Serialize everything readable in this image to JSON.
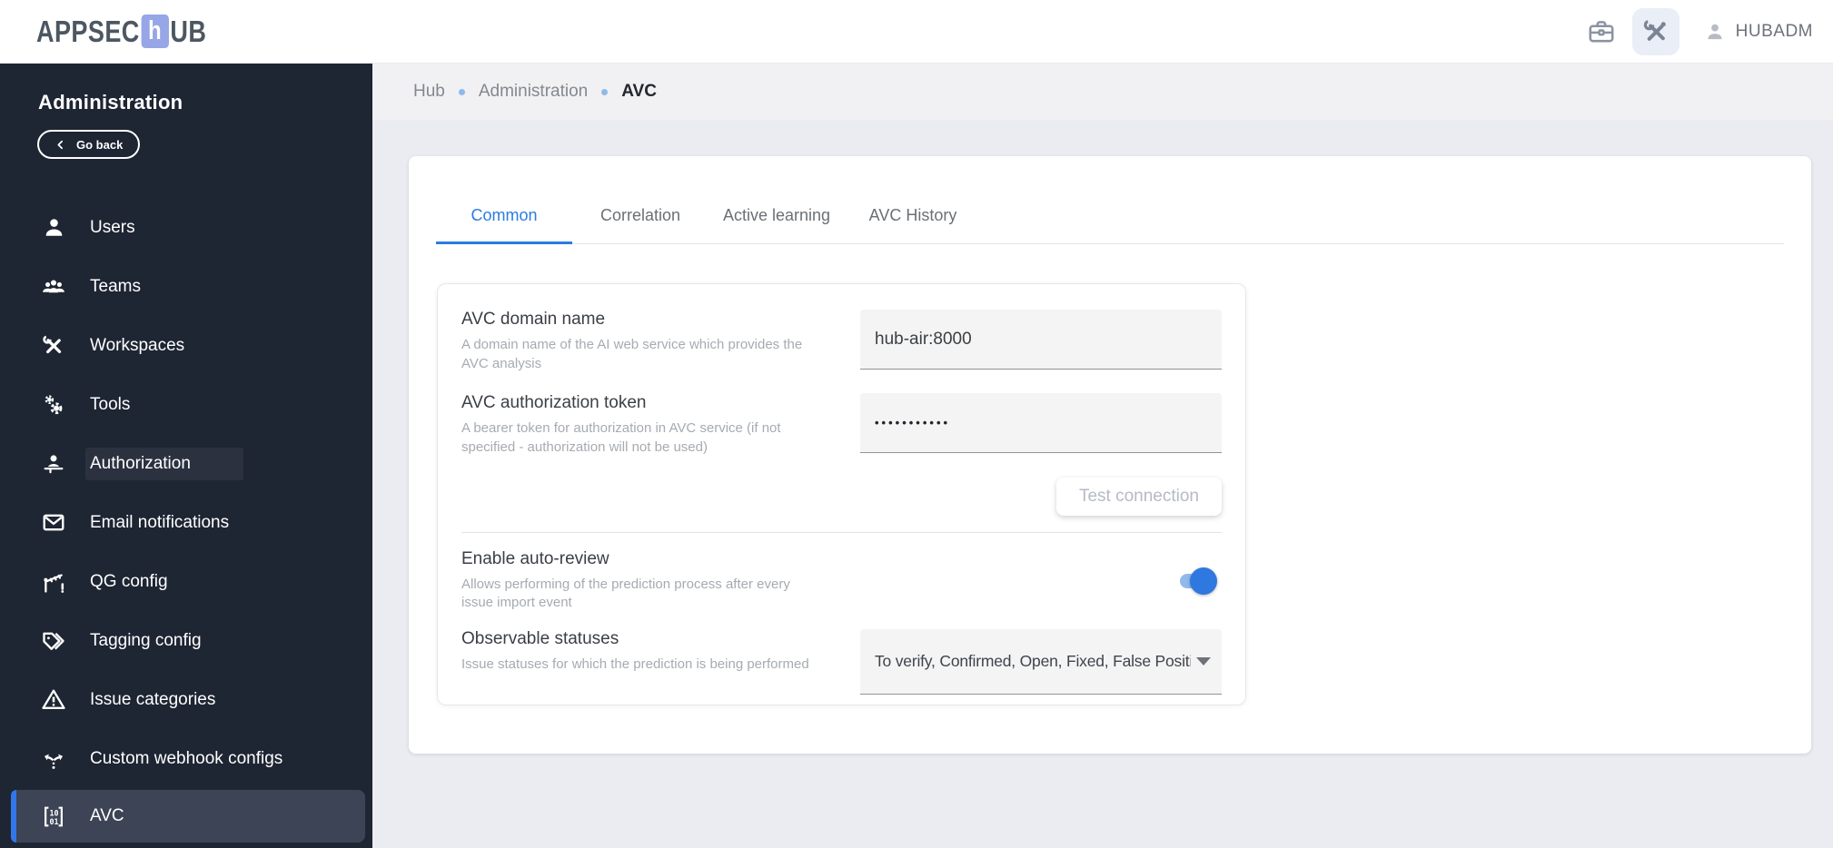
{
  "header": {
    "logo_prefix": "APPSEC",
    "logo_mid": "h",
    "logo_suffix": "UB",
    "username": "HUBADM",
    "icons": [
      "briefcase-icon",
      "admin-tools-icon",
      "person-icon"
    ]
  },
  "sidebar": {
    "title": "Administration",
    "back_label": "Go back",
    "items": [
      {
        "label": "Users",
        "icon": "user-icon"
      },
      {
        "label": "Teams",
        "icon": "teams-icon"
      },
      {
        "label": "Workspaces",
        "icon": "workspaces-icon"
      },
      {
        "label": "Tools",
        "icon": "gears-icon"
      },
      {
        "label": "Authorization",
        "icon": "authorization-icon",
        "highlighted": true
      },
      {
        "label": "Email notifications",
        "icon": "envelope-icon"
      },
      {
        "label": "QG config",
        "icon": "quality-gate-icon"
      },
      {
        "label": "Tagging config",
        "icon": "tags-icon"
      },
      {
        "label": "Issue categories",
        "icon": "warning-triangle-icon"
      },
      {
        "label": "Custom webhook configs",
        "icon": "route-split-icon"
      },
      {
        "label": "AVC",
        "icon": "binary-matrix-icon",
        "selected": true
      }
    ]
  },
  "breadcrumb": {
    "items": [
      {
        "label": "Hub",
        "current": false
      },
      {
        "label": "Administration",
        "current": false
      },
      {
        "label": "AVC",
        "current": true
      }
    ]
  },
  "tabs": [
    {
      "label": "Common",
      "active": true
    },
    {
      "label": "Correlation",
      "active": false
    },
    {
      "label": "Active learning",
      "active": false
    },
    {
      "label": "AVC History",
      "active": false
    }
  ],
  "form": {
    "domain": {
      "label": "AVC domain name",
      "help": "A domain name of the AI web service which provides the AVC analysis",
      "value": "hub-air:8000"
    },
    "token": {
      "label": "AVC authorization token",
      "help": "A bearer token for authorization in AVC service (if not specified - authorization will not be used)",
      "value_masked": "•••••••••••"
    },
    "test_button_label": "Test connection",
    "auto_review": {
      "label": "Enable auto-review",
      "help": "Allows performing of the prediction process after every issue import event",
      "enabled": true
    },
    "observable": {
      "label": "Observable statuses",
      "help": "Issue statuses for which the prediction is being performed",
      "value": "To verify, Confirmed, Open, Fixed, False Positi..."
    }
  },
  "colors": {
    "main_bg": "#ebecf1",
    "breadcrumb_bg": "#f1f1f3",
    "sidebar_bg": "#1e2533",
    "sidebar_selected_bg": "#3c4456",
    "selected_bar": "#3277e8",
    "logo_accent": "#97a6e6",
    "header_tools_bg": "#e9eef7",
    "tab_active": "#2a7ce2",
    "toggle_on": "#2e78df",
    "toggle_track": "#92b9ec"
  }
}
